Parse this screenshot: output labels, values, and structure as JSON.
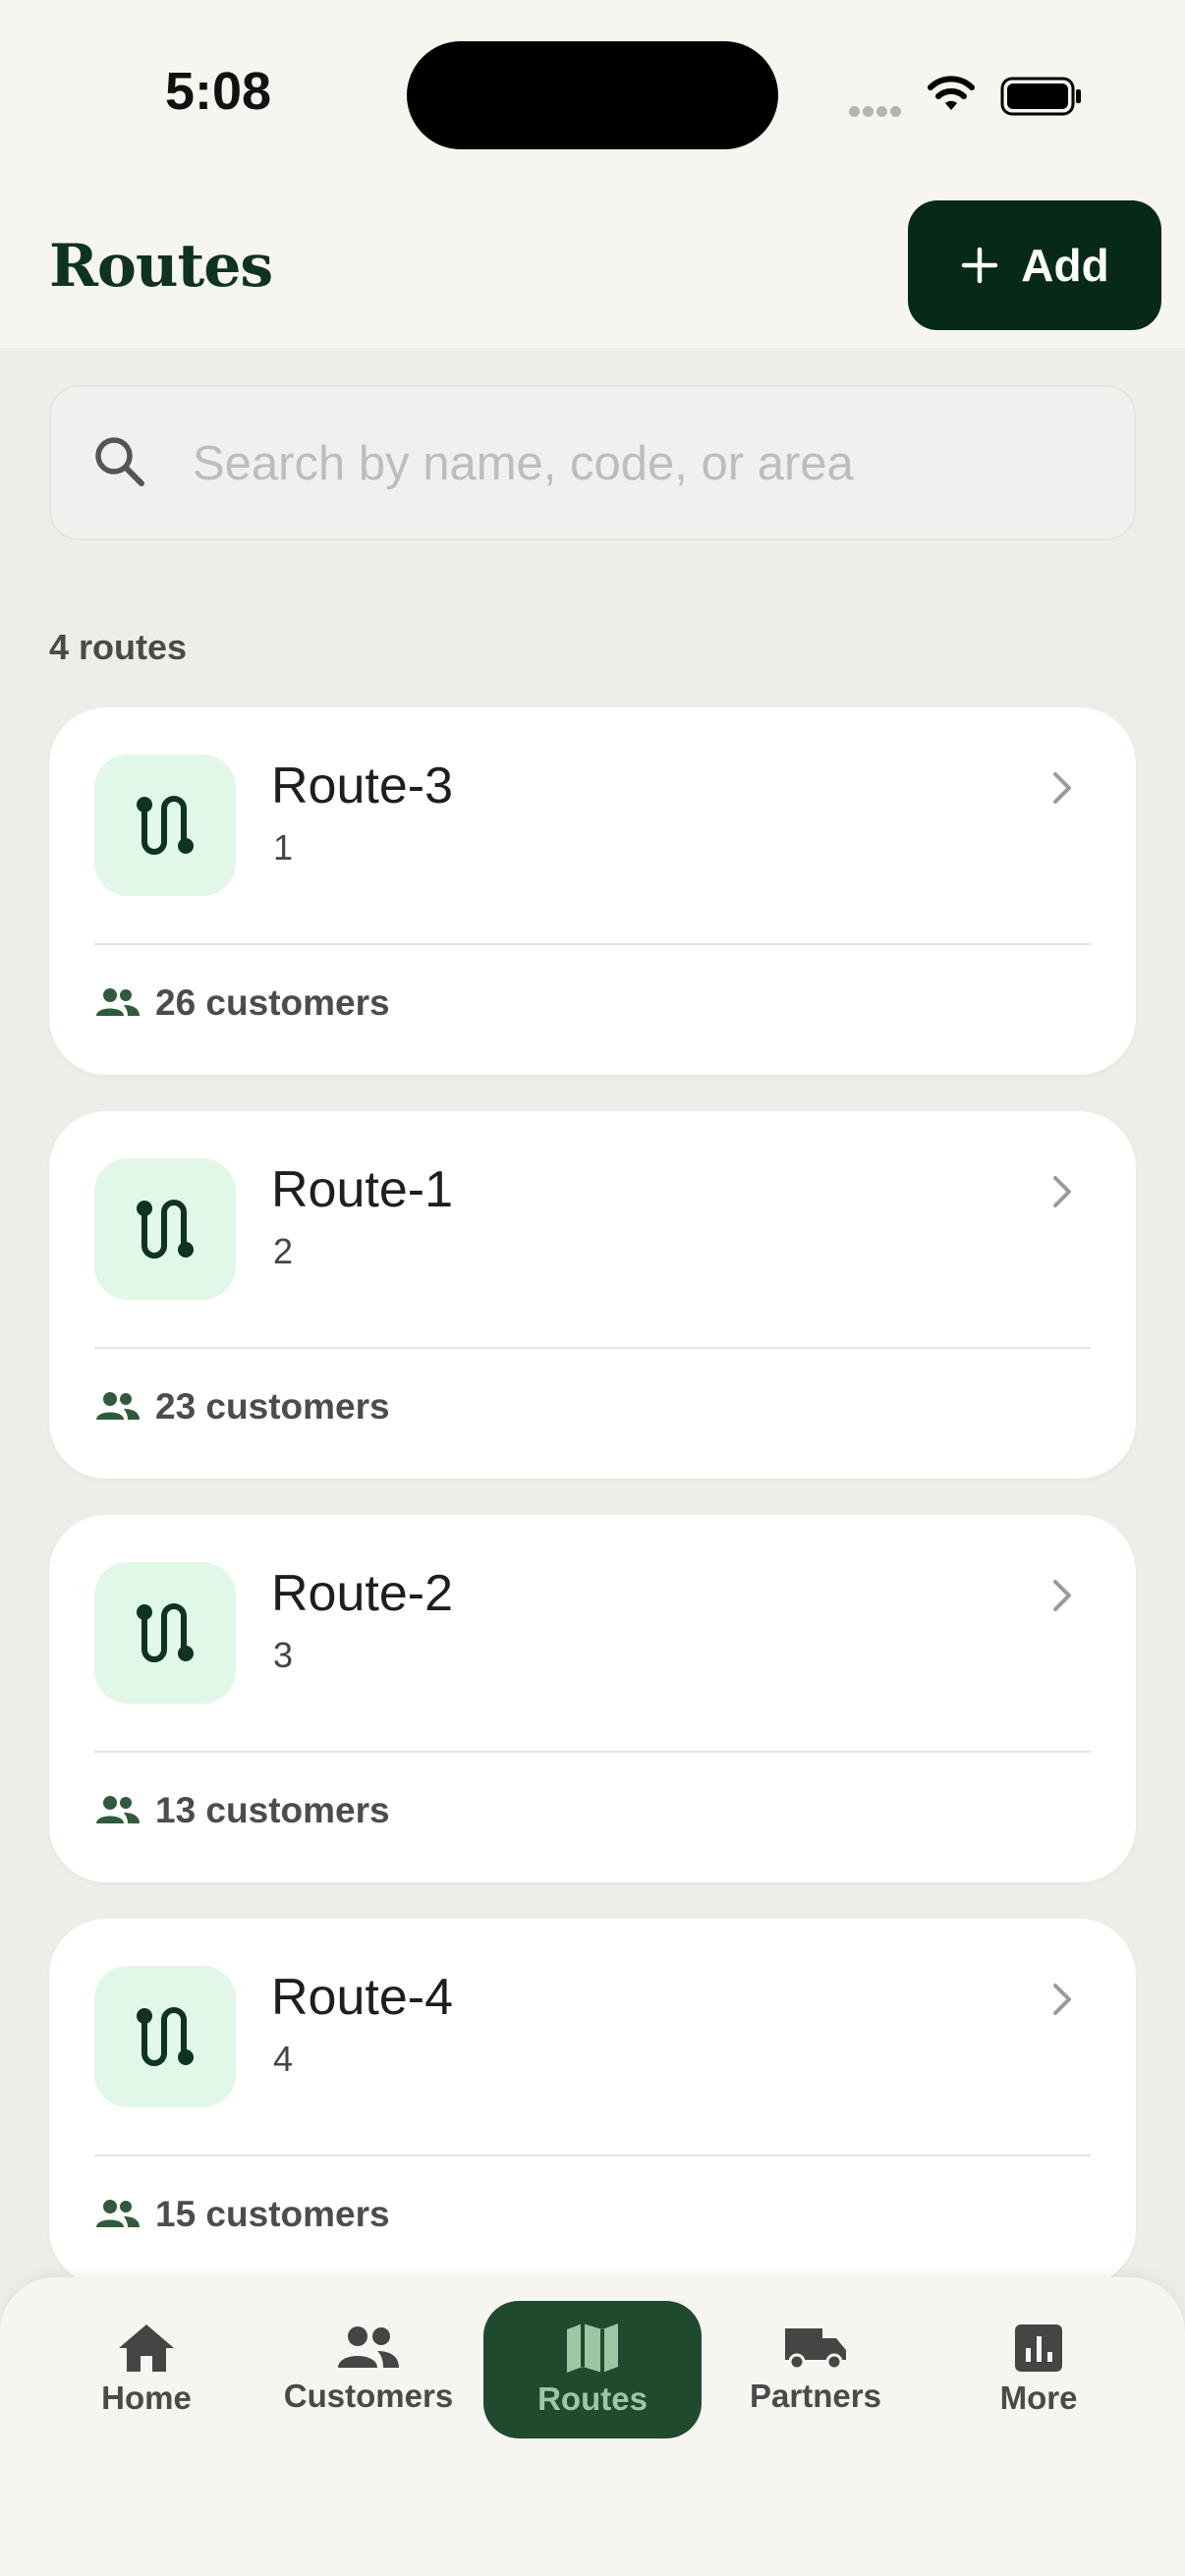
{
  "status_bar": {
    "time": "5:08"
  },
  "header": {
    "title": "Routes",
    "add_label": "Add"
  },
  "search": {
    "placeholder": "Search by name, code, or area"
  },
  "routes_count": "4 routes",
  "routes": [
    {
      "name": "Route-3",
      "code": "1",
      "customers": "26 customers"
    },
    {
      "name": "Route-1",
      "code": "2",
      "customers": "23 customers"
    },
    {
      "name": "Route-2",
      "code": "3",
      "customers": "13 customers"
    },
    {
      "name": "Route-4",
      "code": "4",
      "customers": "15 customers"
    }
  ],
  "nav": {
    "items": [
      {
        "label": "Home",
        "icon": "home-icon"
      },
      {
        "label": "Customers",
        "icon": "people-icon"
      },
      {
        "label": "Routes",
        "icon": "map-icon",
        "active": true
      },
      {
        "label": "Partners",
        "icon": "truck-icon"
      },
      {
        "label": "More",
        "icon": "chart-icon"
      }
    ]
  },
  "colors": {
    "brand_dark": "#072a18",
    "accent_light": "#e1f7e7",
    "active_nav": "#1f4a2d"
  }
}
